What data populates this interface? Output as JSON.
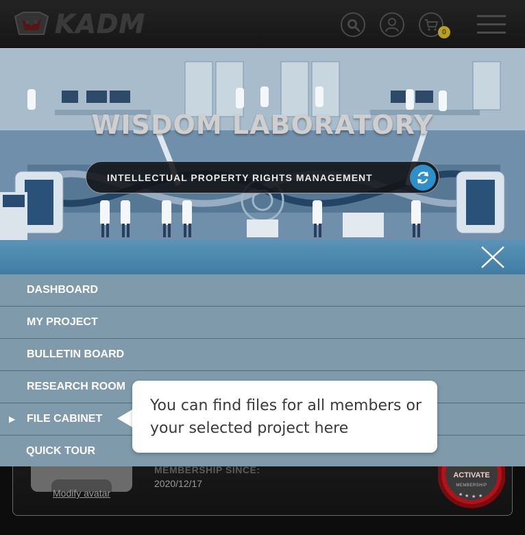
{
  "header": {
    "logo_text": "KADM",
    "search_icon": "search-icon",
    "account_icon": "user-icon",
    "cart_icon": "cart-icon",
    "cart_count": "0",
    "menu_icon": "hamburger-icon"
  },
  "banner": {
    "title": "WISDOM LABORATORY",
    "project_switcher": {
      "label": "INTELLECTUAL PROPERTY RIGHTS MANAGEMENT",
      "icon": "refresh-icon"
    }
  },
  "menu": {
    "close_icon": "close-icon",
    "active_index": 4,
    "items": [
      {
        "label": "DASHBOARD"
      },
      {
        "label": "MY PROJECT"
      },
      {
        "label": "BULLETIN BOARD"
      },
      {
        "label": "RESEARCH ROOM"
      },
      {
        "label": "FILE CABINET"
      },
      {
        "label": "QUICK TOUR"
      }
    ]
  },
  "callout": {
    "text": "You can find files for all members or your selected project here"
  },
  "profile": {
    "modify_avatar": "Modify avatar",
    "membership_since_label": "MEMBERSHIP SINCE:",
    "membership_date": "2020/12/17",
    "badge_label": "ACTIVATE",
    "badge_sub": "MEMBERSHIP"
  },
  "colors": {
    "header_bg": "#1b1b1b",
    "accent_blue": "#2f8fc8",
    "menu_bg": "#7f9aaa",
    "close_strip": "#4a86ad",
    "badge_red": "#b0141a"
  }
}
